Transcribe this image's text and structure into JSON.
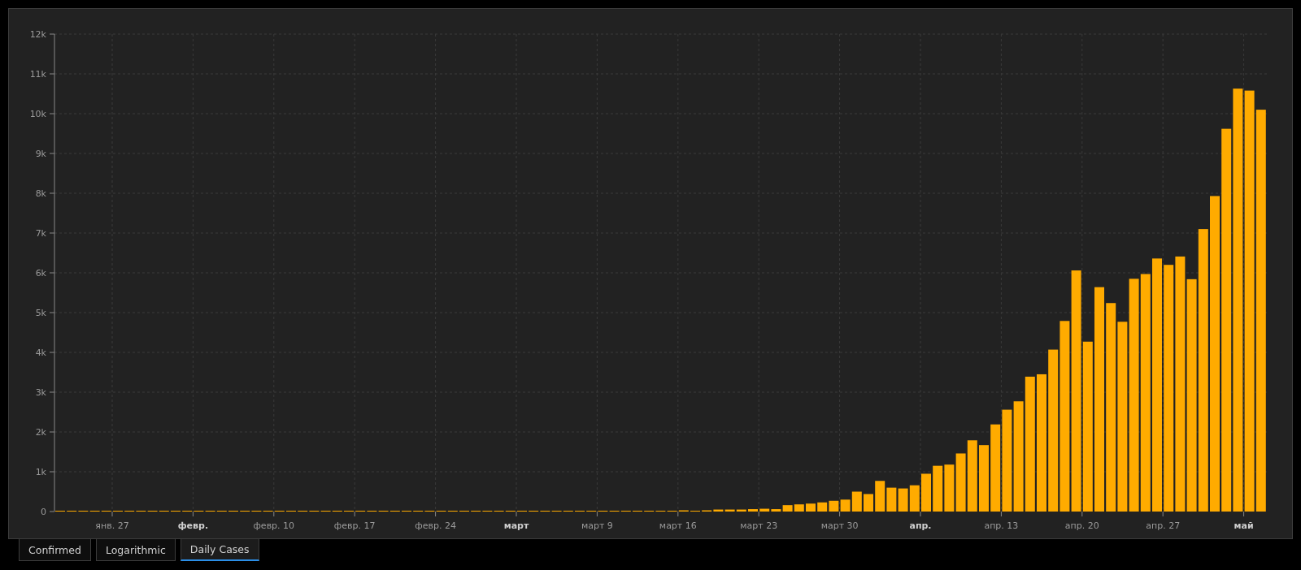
{
  "chart": {
    "chart_data": {
      "type": "bar",
      "orientation": "vertical",
      "grid": true,
      "categories": [
        null,
        null,
        null,
        null,
        null,
        "янв. 27",
        null,
        null,
        null,
        null,
        null,
        null,
        "**февр.**",
        null,
        null,
        null,
        null,
        null,
        null,
        "февр. 10",
        null,
        null,
        null,
        null,
        null,
        null,
        "февр. 17",
        null,
        null,
        null,
        null,
        null,
        null,
        "февр. 24",
        null,
        null,
        null,
        null,
        null,
        null,
        "**март**",
        null,
        null,
        null,
        null,
        null,
        null,
        "март 9",
        null,
        null,
        null,
        null,
        null,
        null,
        "март 16",
        null,
        null,
        null,
        null,
        null,
        null,
        "март 23",
        null,
        null,
        null,
        null,
        null,
        null,
        "март 30",
        null,
        null,
        null,
        null,
        null,
        null,
        "**апр.**",
        null,
        null,
        null,
        null,
        null,
        null,
        "апр. 13",
        null,
        null,
        null,
        null,
        null,
        null,
        "апр. 20",
        null,
        null,
        null,
        null,
        null,
        null,
        "апр. 27",
        null,
        null,
        null,
        null,
        null,
        null,
        "**май**",
        null
      ],
      "series": [
        {
          "color": "#ffab00",
          "values": [
            0,
            0,
            0,
            0,
            0,
            0,
            0,
            0,
            0,
            0,
            0,
            0,
            0,
            0,
            0,
            0,
            0,
            0,
            0,
            0,
            0,
            0,
            0,
            0,
            0,
            0,
            0,
            0,
            0,
            0,
            0,
            0,
            0,
            0,
            0,
            0,
            0,
            0,
            0,
            0,
            0,
            0,
            0,
            0,
            10,
            0,
            0,
            0,
            0,
            0,
            10,
            20,
            10,
            0,
            30,
            20,
            30,
            50,
            50,
            50,
            60,
            70,
            60,
            160,
            180,
            200,
            230,
            270,
            300,
            500,
            440,
            770,
            600,
            580,
            660,
            950,
            1150,
            1180,
            1460,
            1790,
            1670,
            2190,
            2560,
            2770,
            3390,
            3450,
            4070,
            4790,
            6060,
            4270,
            5640,
            5240,
            4770,
            5850,
            5970,
            6360,
            6200,
            6410,
            5840,
            7100,
            7930,
            9620,
            10630,
            10580,
            10100
          ]
        }
      ],
      "ylim": [
        0,
        12000
      ],
      "yticks": [
        {
          "value": 0,
          "label": "0"
        },
        {
          "value": 1000,
          "label": "1k"
        },
        {
          "value": 2000,
          "label": "2k"
        },
        {
          "value": 3000,
          "label": "3k"
        },
        {
          "value": 4000,
          "label": "4k"
        },
        {
          "value": 5000,
          "label": "5k"
        },
        {
          "value": 6000,
          "label": "6k"
        },
        {
          "value": 7000,
          "label": "7k"
        },
        {
          "value": 8000,
          "label": "8k"
        },
        {
          "value": 9000,
          "label": "9k"
        },
        {
          "value": 10000,
          "label": "10k"
        },
        {
          "value": 11000,
          "label": "11k"
        },
        {
          "value": 12000,
          "label": "12k"
        }
      ]
    }
  },
  "tabs": [
    {
      "label": "Confirmed",
      "selected": false
    },
    {
      "label": "Logarithmic",
      "selected": false
    },
    {
      "label": "Daily Cases",
      "selected": true
    }
  ]
}
